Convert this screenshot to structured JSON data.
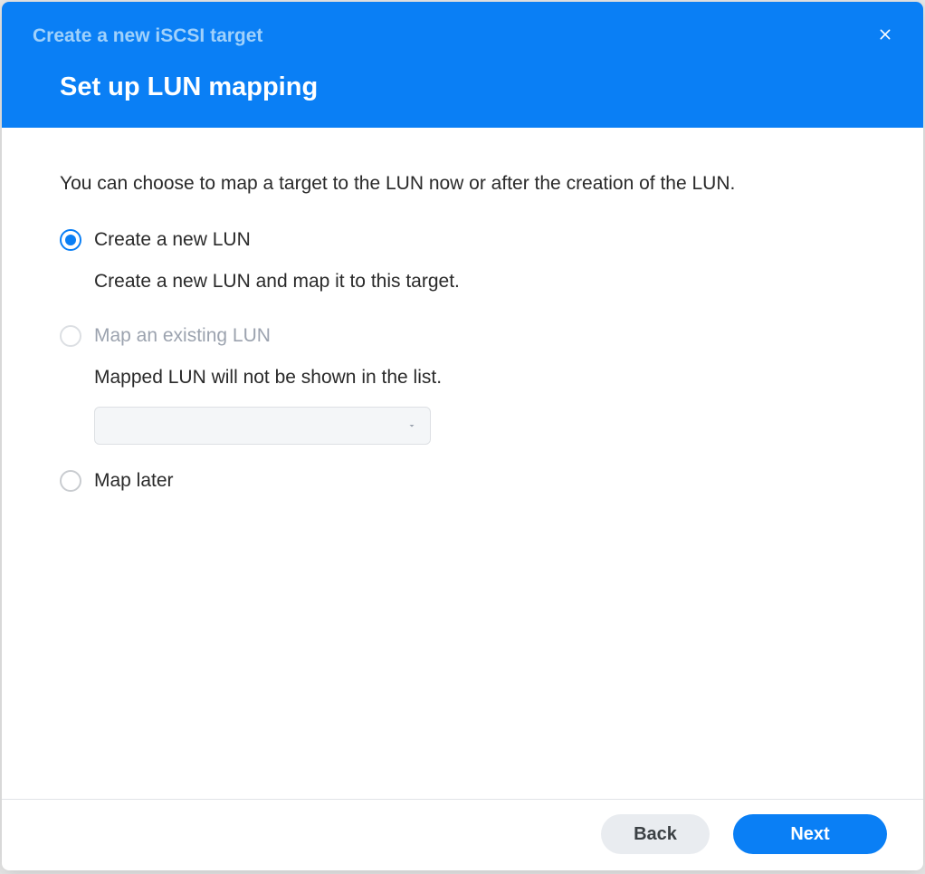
{
  "dialog": {
    "title": "Create a new iSCSI target",
    "subtitle": "Set up LUN mapping"
  },
  "body": {
    "intro": "You can choose to map a target to the LUN now or after the creation of the LUN.",
    "options": {
      "create_new": {
        "label": "Create a new LUN",
        "description": "Create a new LUN and map it to this target.",
        "selected": true
      },
      "map_existing": {
        "label": "Map an existing LUN",
        "description": "Mapped LUN will not be shown in the list.",
        "disabled": true,
        "dropdown_value": ""
      },
      "map_later": {
        "label": "Map later"
      }
    }
  },
  "footer": {
    "back": "Back",
    "next": "Next"
  }
}
